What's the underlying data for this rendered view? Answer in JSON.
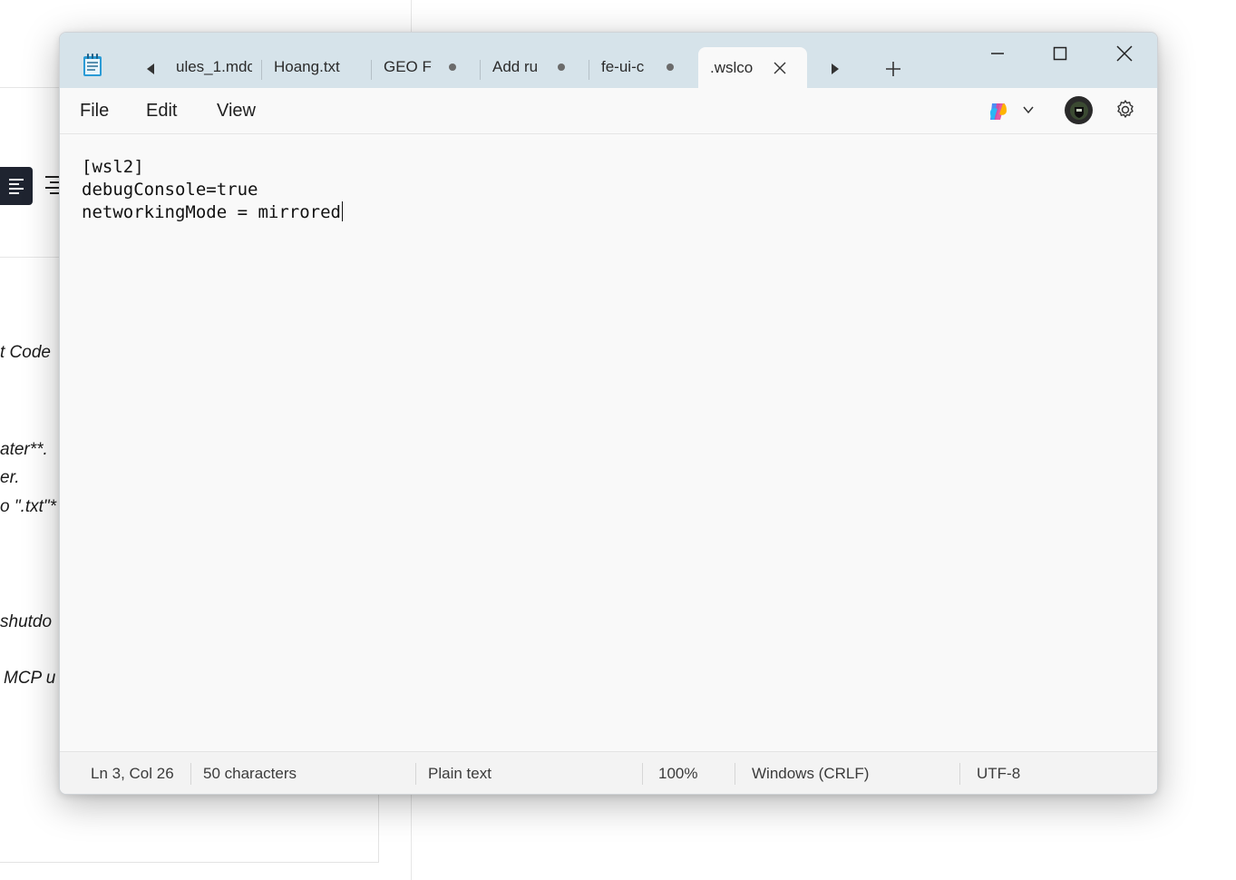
{
  "background": {
    "snippets": [
      "t Code",
      "ater**.",
      "er.",
      "o \".txt\"*",
      "shutdo",
      "MCP u"
    ]
  },
  "window": {
    "app_icon": "notepad-icon",
    "tabs": [
      {
        "label": "ules_1.mdc",
        "modified": false,
        "active": false
      },
      {
        "label": "Hoang.txt",
        "modified": false,
        "active": false
      },
      {
        "label": "GEO F",
        "modified": true,
        "active": false
      },
      {
        "label": "Add ru",
        "modified": true,
        "active": false
      },
      {
        "label": "fe-ui-c",
        "modified": true,
        "active": false
      },
      {
        "label": ".wslco",
        "modified": false,
        "active": true
      }
    ],
    "menu": {
      "file": "File",
      "edit": "Edit",
      "view": "View"
    },
    "icons": {
      "copilot": "copilot-icon",
      "avatar": "user-avatar",
      "settings": "gear-icon",
      "minimize": "minimize-icon",
      "maximize": "maximize-icon",
      "close": "close-icon"
    }
  },
  "editor": {
    "lines": [
      "[wsl2]",
      "debugConsole=true",
      "networkingMode = mirrored"
    ]
  },
  "status": {
    "position": "Ln 3, Col 26",
    "characters": "50 characters",
    "format": "Plain text",
    "zoom": "100%",
    "line_ending": "Windows (CRLF)",
    "encoding": "UTF-8"
  },
  "colors": {
    "titlebar": "#d6e3ea",
    "window_bg": "#f9f9f9",
    "statusbar": "#f3f3f3"
  }
}
